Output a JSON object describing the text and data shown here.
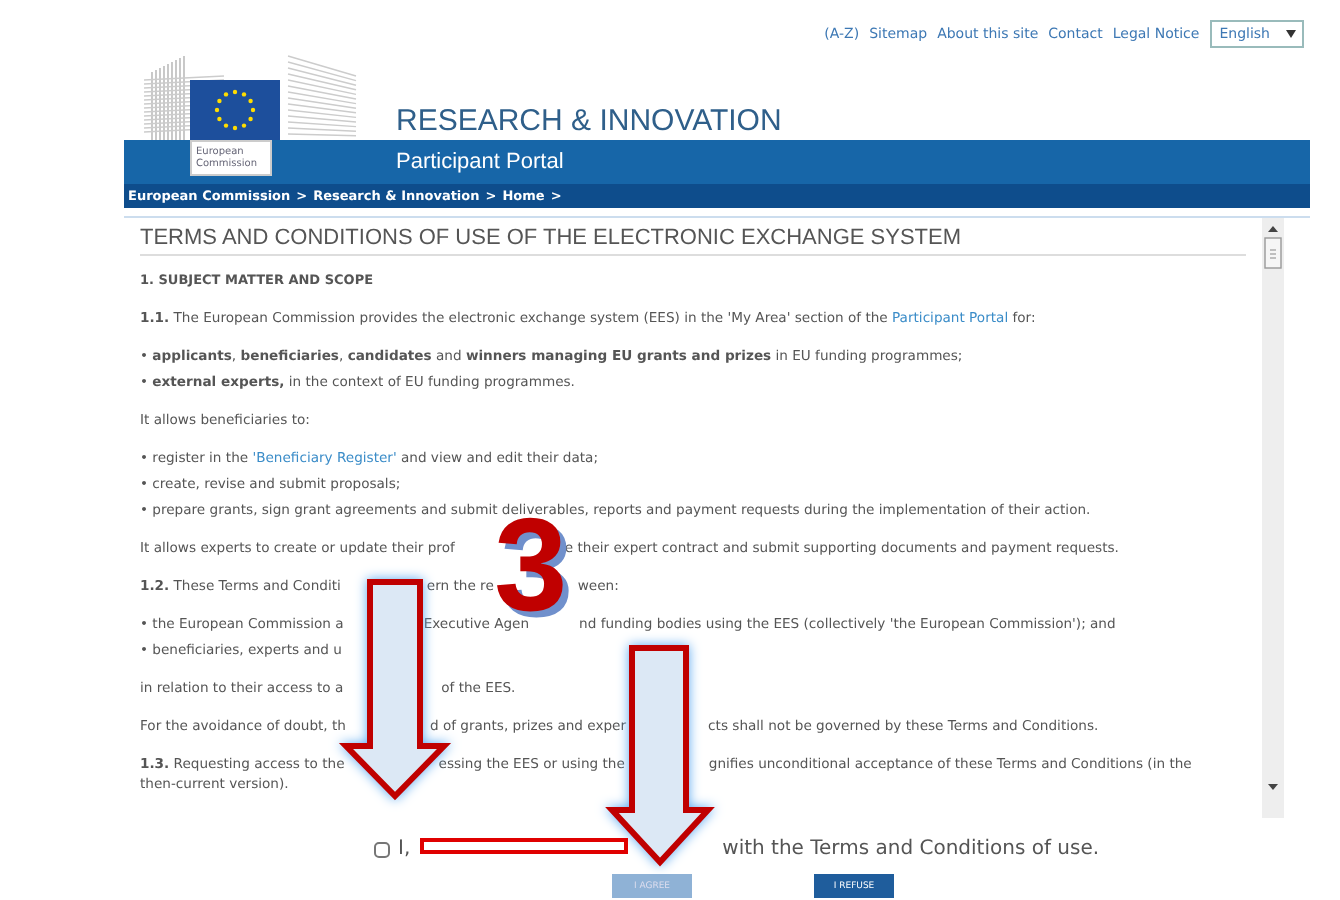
{
  "header": {
    "top_links": [
      "(A-Z)",
      "Sitemap",
      "About this site",
      "Contact",
      "Legal Notice"
    ],
    "language_select": {
      "value": "English"
    },
    "logo_caption": "European Commission",
    "site_title": "RESEARCH & INNOVATION",
    "site_subtitle": "Participant Portal",
    "breadcrumb": {
      "items": [
        "European Commission",
        "Research & Innovation",
        "Home"
      ],
      "separator": ">"
    }
  },
  "terms": {
    "title": "TERMS AND CONDITIONS OF USE OF THE ELECTRONIC EXCHANGE SYSTEM",
    "lines": [
      {
        "kind": "heading",
        "parts": [
          [
            "1. SUBJECT MATTER AND SCOPE"
          ]
        ]
      },
      {
        "kind": "para",
        "parts": [
          [
            "**1.1.** The European Commission provides the electronic exchange system (EES) in the 'My Area' section of the ",
            {
              "link": "Participant Portal"
            },
            " for:"
          ]
        ]
      },
      {
        "kind": "bullet",
        "parts": [
          [
            "• **applicants**, **beneficiaries**, **candidates** and **winners managing EU grants and prizes** in EU funding programmes;"
          ]
        ]
      },
      {
        "kind": "bullet2",
        "parts": [
          [
            "• **external experts,** in the context of EU funding programmes."
          ]
        ]
      },
      {
        "kind": "para",
        "parts": [
          [
            "It allows beneficiaries to:"
          ]
        ]
      },
      {
        "kind": "bullet",
        "parts": [
          [
            "• register in the ",
            {
              "link": "'Beneficiary Register'"
            },
            " and view and edit their data;"
          ]
        ]
      },
      {
        "kind": "bullet2",
        "parts": [
          [
            "• create, revise and submit proposals;"
          ]
        ]
      },
      {
        "kind": "bullet2",
        "parts": [
          [
            "• prepare grants, sign grant agreements and submit deliverables, reports and payment requests during the implementation of their action."
          ]
        ]
      },
      {
        "kind": "para",
        "parts": [
          [
            "It allows experts to create or update their prof"
          ],
          [
            "e their expert contract and submit supporting documents and payment requests."
          ]
        ]
      },
      {
        "kind": "para",
        "parts": [
          [
            "**1.2.** These Terms and Conditi"
          ],
          [
            "ern the re"
          ],
          [
            "ween:"
          ]
        ]
      },
      {
        "kind": "bullet",
        "parts": [
          [
            "• the European Commission a"
          ],
          [
            "Executive Agen"
          ],
          [
            "nd funding bodies using the EES (collectively 'the European Commission'); and"
          ]
        ]
      },
      {
        "kind": "bullet2",
        "parts": [
          [
            "• beneficiaries, experts and u"
          ]
        ]
      },
      {
        "kind": "para",
        "parts": [
          [
            "in relation to their access to a"
          ],
          [
            "of the EES."
          ]
        ]
      },
      {
        "kind": "para",
        "parts": [
          [
            "For the avoidance of doubt, th"
          ],
          [
            "d of grants, prizes and exper"
          ],
          [
            "cts shall not be governed by these Terms and Conditions."
          ]
        ]
      },
      {
        "kind": "para",
        "parts": [
          [
            "**1.3.** Requesting access to the"
          ],
          [
            "essing the EES or using the"
          ],
          [
            "gnifies unconditional acceptance of these Terms and Conditions (in the"
          ]
        ]
      },
      {
        "kind": "cont",
        "parts": [
          [
            "then-current version)."
          ]
        ]
      }
    ]
  },
  "agreement": {
    "checked": false,
    "text_before": "I,",
    "text_after": "with the Terms and Conditions of use."
  },
  "buttons": [
    {
      "label": "I AGREE",
      "disabled": true
    },
    {
      "label": "I REFUSE",
      "disabled": false
    }
  ],
  "annotation": {
    "number": "3"
  }
}
